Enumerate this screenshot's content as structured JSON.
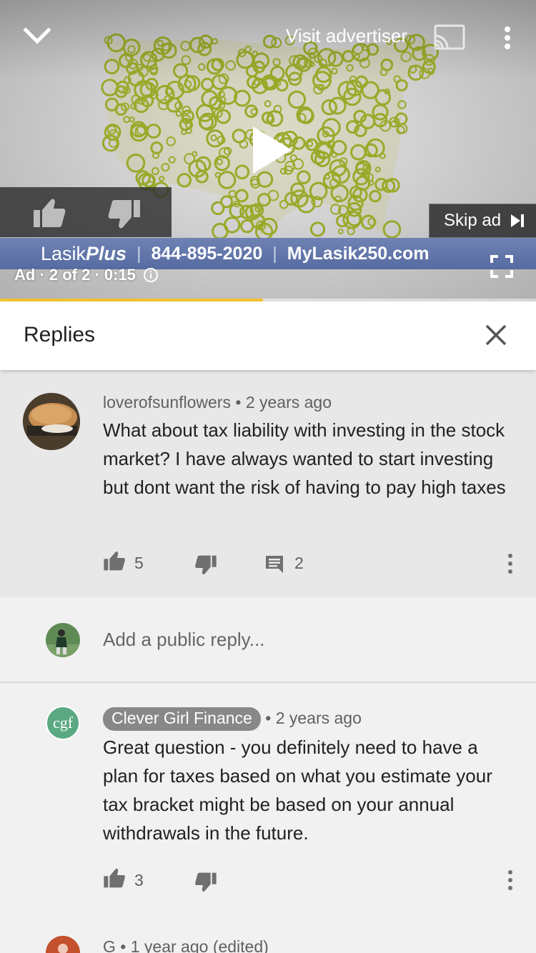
{
  "player": {
    "visit_advertiser": "Visit advertiser",
    "skip_label": "Skip ad",
    "banner": {
      "brand_text": "Lasik",
      "brand_bold": "Plus",
      "phone": "844-895-2020",
      "site": "MyLasik250.com"
    },
    "ad_info": "Ad · 2 of 2 · 0:15",
    "progress": 0.49
  },
  "panel": {
    "title": "Replies"
  },
  "comment": {
    "author": "loverofsunflowers",
    "time": "2 years ago",
    "text": "What about tax liability with investing in the stock market? I have always wanted to start investing but dont want the risk of having to pay high taxes",
    "likes": "5",
    "replies": "2"
  },
  "reply_box": {
    "placeholder": "Add a public reply..."
  },
  "replies": [
    {
      "author": "Clever Girl Finance",
      "avatar_text": "cgf",
      "time": "2 years ago",
      "text": "Great question - you definitely need to have a plan for taxes based on what you estimate your tax bracket might be based on your annual withdrawals in the future.",
      "likes": "3"
    },
    {
      "author": "G",
      "time": "1 year ago (edited)"
    }
  ],
  "separator": "•",
  "colors": {
    "progress": "#f2c230",
    "banner": "#6276aa",
    "map_art": "#9aa929"
  },
  "icons": [
    "chevron-down-icon",
    "cast-icon",
    "more-vert-icon",
    "play-icon",
    "thumb-up-icon",
    "thumb-down-icon",
    "skip-next-icon",
    "info-icon",
    "fullscreen-icon",
    "close-icon",
    "comment-icon"
  ]
}
